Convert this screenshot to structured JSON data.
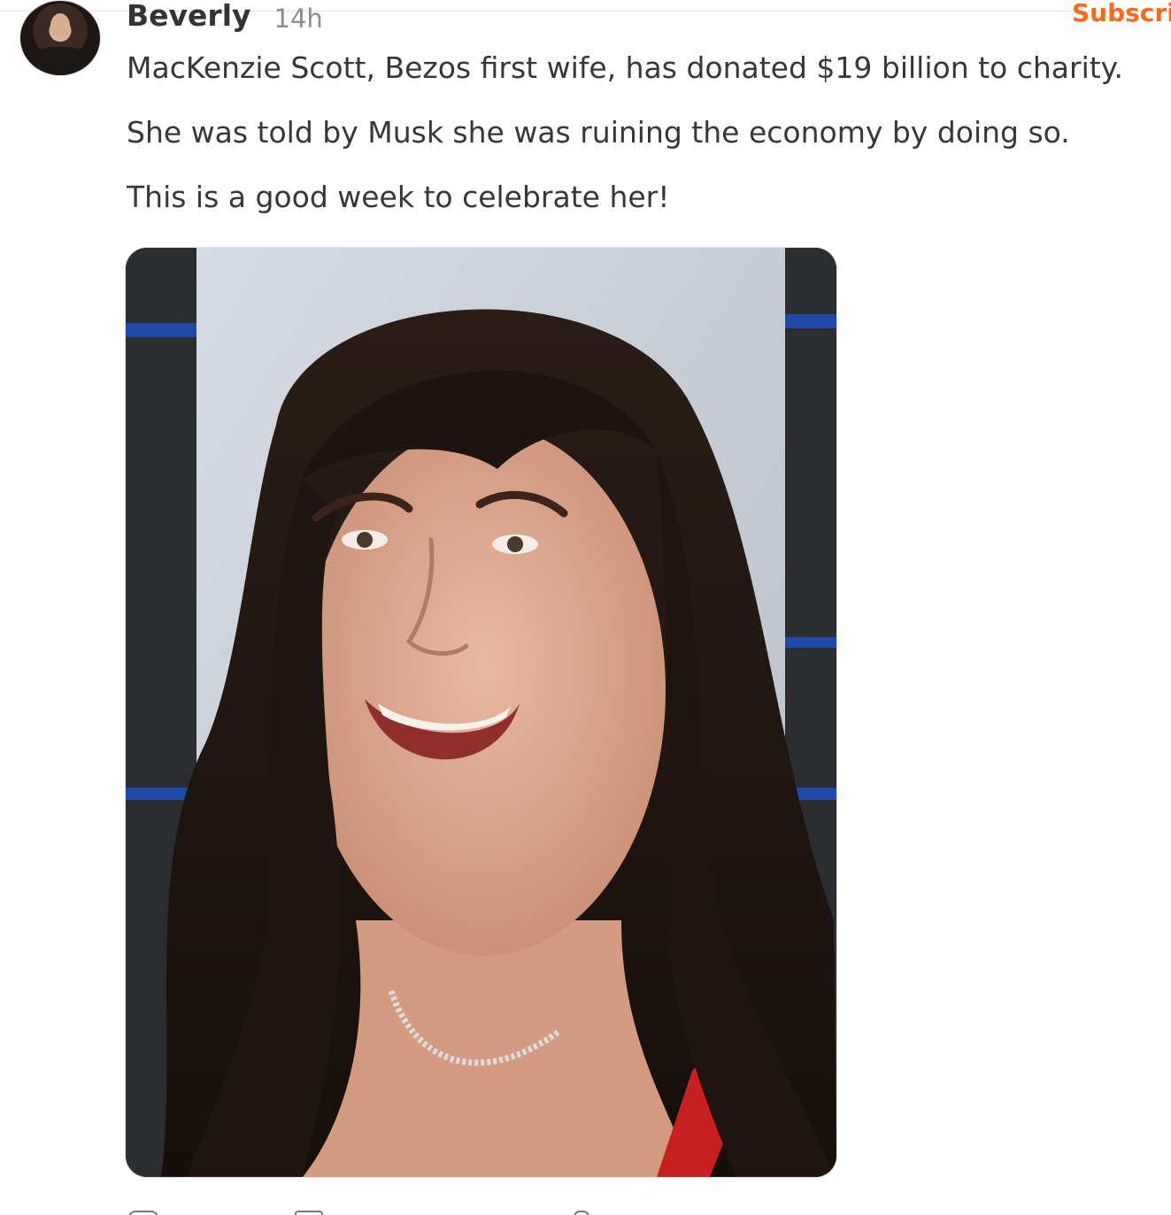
{
  "post": {
    "author": {
      "name": "Beverly",
      "avatar_icon": "profile-avatar"
    },
    "timestamp": "14h",
    "subscribe_label": "Subscri",
    "paragraphs": [
      "MacKenzie Scott, Bezos first wife, has donated $19 billion to charity.",
      "She was told by Musk she was ruining the economy by doing so.",
      "This is a good week to celebrate her!"
    ],
    "image": {
      "subject": "photo-smiling-woman-portrait"
    },
    "actions": [
      {
        "icon": "like-icon"
      },
      {
        "icon": "comment-icon"
      },
      {
        "icon": "share-icon"
      }
    ]
  },
  "colors": {
    "accent": "#ff6719",
    "text": "#363737",
    "muted": "#8d8d8d",
    "divider": "#e6e6e6"
  }
}
